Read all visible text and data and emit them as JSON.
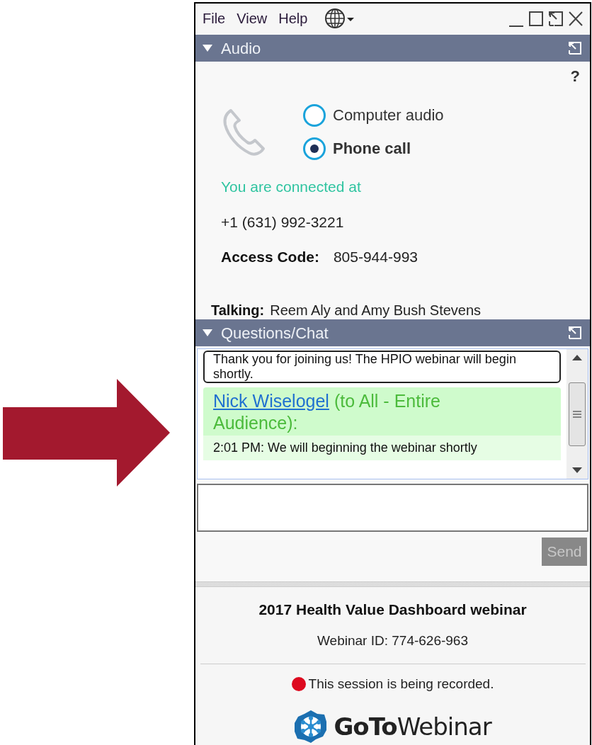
{
  "menu": [
    {
      "label": "File"
    },
    {
      "label": "View"
    },
    {
      "label": "Help"
    }
  ],
  "audio": {
    "title": "Audio",
    "expanded": true,
    "help": "?",
    "options": [
      {
        "label": "Computer audio",
        "selected": false
      },
      {
        "label": "Phone call",
        "selected": true
      }
    ],
    "status": "You are connected at",
    "phone": "+1 (631) 992-3221",
    "access_code_label": "Access Code:",
    "access_code": "805-944-993",
    "talking_label": "Talking:",
    "talking": "Reem Aly and Amy Bush Stevens"
  },
  "chat": {
    "title": "Questions/Chat",
    "expanded": true,
    "messages": [
      {
        "kind": "notice",
        "text": "Thank you for joining us! The HPIO webinar will begin shortly."
      },
      {
        "kind": "message",
        "sender": "Nick Wiselogel",
        "recipient": "(to All - Entire Audience):",
        "text": "2:01 PM: We will beginning the webinar shortly"
      }
    ],
    "send_button": {
      "label": "Send",
      "disabled": true
    }
  },
  "footer": {
    "title": "2017 Health Value Dashboard webinar",
    "webinar_id": "Webinar ID: 774-626-963",
    "recording": "This session is being recorded.",
    "logo": "**GoTo**Webinar"
  }
}
